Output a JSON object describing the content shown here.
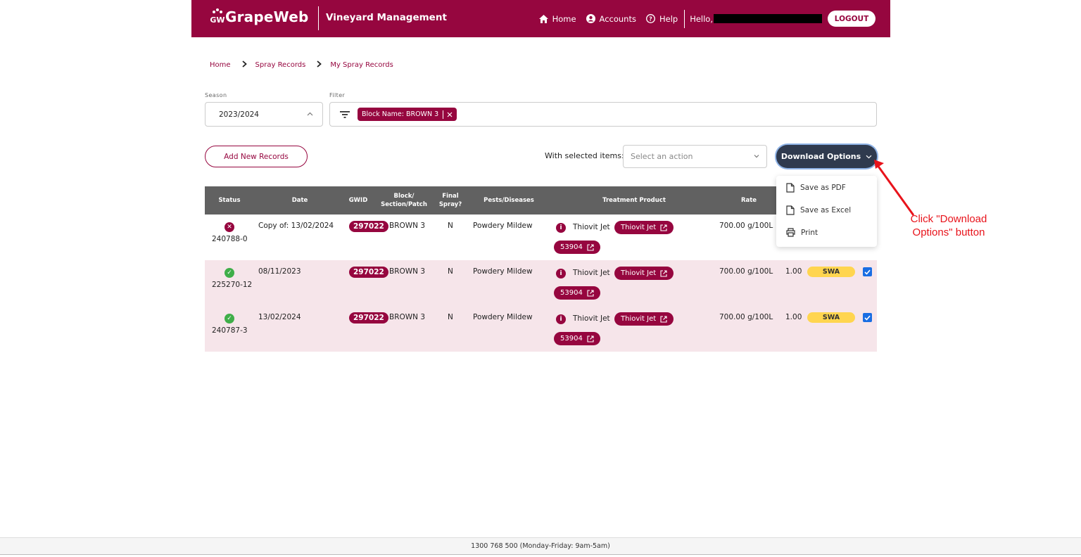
{
  "header": {
    "logo_text": "GrapeWeb",
    "logo_mark": "GW",
    "app_title": "Vineyard Management",
    "nav": [
      {
        "label": "Home",
        "icon": "home-icon"
      },
      {
        "label": "Accounts",
        "icon": "account-icon"
      },
      {
        "label": "Help",
        "icon": "help-icon"
      }
    ],
    "hello": "Hello,",
    "logout_label": "LOGOUT",
    "brand_color": "#96063f"
  },
  "breadcrumb": [
    "Home",
    "Spray Records",
    "My Spray Records"
  ],
  "season": {
    "label": "Season",
    "value": "2023/2024"
  },
  "filter": {
    "label": "Filter",
    "chip": "Block Name: BROWN 3"
  },
  "actions": {
    "add_label": "Add New Records",
    "with_selected": "With selected items:",
    "select_placeholder": "Select an action",
    "download_label": "Download Options"
  },
  "download_menu": [
    "Save as PDF",
    "Save as Excel",
    "Print"
  ],
  "table": {
    "headers": {
      "status": "Status",
      "date": "Date",
      "gwid": "GWID",
      "block": "Block/ Section/Patch",
      "final": "Final Spray?",
      "pests": "Pests/Diseases",
      "product": "Treatment Product",
      "rate": "Rate"
    },
    "rows": [
      {
        "status": "error",
        "status_id": "240788-0",
        "date": "Copy of: 13/02/2024",
        "gwid": "297022",
        "block": "BROWN 3",
        "final": "N",
        "pests": "Powdery Mildew",
        "product": "Thiovit Jet",
        "product_link": "Thiovit Jet",
        "code": "53904",
        "rate": "700.00 g/100L",
        "factor": "",
        "tag": "",
        "checked": false
      },
      {
        "status": "ok",
        "status_id": "225270-12",
        "date": "08/11/2023",
        "gwid": "297022",
        "block": "BROWN 3",
        "final": "N",
        "pests": "Powdery Mildew",
        "product": "Thiovit Jet",
        "product_link": "Thiovit Jet",
        "code": "53904",
        "rate": "700.00 g/100L",
        "factor": "1.00",
        "tag": "SWA",
        "checked": true
      },
      {
        "status": "ok",
        "status_id": "240787-3",
        "date": "13/02/2024",
        "gwid": "297022",
        "block": "BROWN 3",
        "final": "N",
        "pests": "Powdery Mildew",
        "product": "Thiovit Jet",
        "product_link": "Thiovit Jet",
        "code": "53904",
        "rate": "700.00 g/100L",
        "factor": "1.00",
        "tag": "SWA",
        "checked": true
      }
    ]
  },
  "annotation": "Click \"Download Options\" button",
  "footer": "1300 768 500 (Monday-Friday: 9am-5am)"
}
